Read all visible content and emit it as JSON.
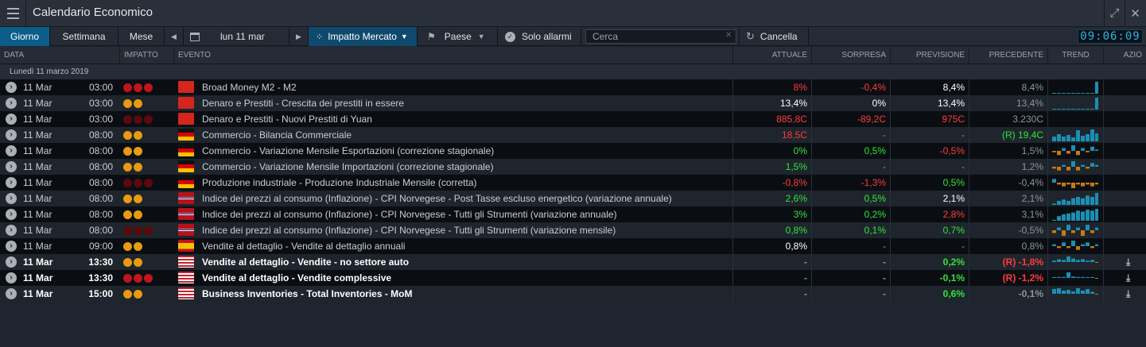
{
  "window": {
    "title": "Calendario Economico",
    "menu_icon": "hamburger-icon",
    "expand_icon": "expand-icon",
    "close_icon": "close-icon"
  },
  "toolbar": {
    "tabs": [
      "Giorno",
      "Settimana",
      "Mese"
    ],
    "date": "lun 11 mar",
    "impact_filter": "Impatto Mercato",
    "country_filter": "Paese",
    "alarms_only": "Solo allarmi",
    "search_placeholder": "Cerca",
    "clear": "Cancella",
    "clock": "09:06:09"
  },
  "columns": [
    "DATA",
    "IMPATTO",
    "EVENTO",
    "ATTUALE",
    "SORPRESA",
    "PREVISIONE",
    "PRECEDENTE",
    "TREND",
    "AZIO"
  ],
  "group_label": "Lunedì 11 marzo 2019",
  "colors": {
    "positive": "#33e33a",
    "negative": "#ff3b3b",
    "trend_up": "#1b8fb3",
    "trend_down": "#c47a15",
    "accent": "#0b5e8a"
  },
  "rows": [
    {
      "date": "11 Mar",
      "time": "03:00",
      "impact": [
        "red",
        "red",
        "red"
      ],
      "flag": "CN",
      "event": "Broad Money M2 - M2",
      "actual": "8%",
      "actual_color": "red",
      "surprise": "-0,4%",
      "surprise_color": "red",
      "forecast": "8,4%",
      "forecast_color": "white",
      "previous": "8,4%",
      "previous_color": "grey",
      "trend": [
        0,
        0,
        0,
        0,
        0,
        0,
        0,
        0,
        0,
        1
      ],
      "bold": false,
      "download": false
    },
    {
      "date": "11 Mar",
      "time": "03:00",
      "impact": [
        "orange",
        "orange"
      ],
      "flag": "CN",
      "event": "Denaro e Prestiti - Crescita dei prestiti in essere",
      "actual": "13,4%",
      "actual_color": "white",
      "surprise": "0%",
      "surprise_color": "white",
      "forecast": "13,4%",
      "forecast_color": "white",
      "previous": "13,4%",
      "previous_color": "grey",
      "trend": [
        0,
        0,
        0,
        0,
        0,
        0,
        0,
        0,
        0,
        1
      ],
      "bold": false,
      "download": false
    },
    {
      "date": "11 Mar",
      "time": "03:00",
      "impact": [
        "darkred",
        "darkred",
        "darkred"
      ],
      "flag": "CN",
      "event": "Denaro e Prestiti - Nuovi Prestiti di Yuan",
      "actual": "885,8C",
      "actual_color": "red",
      "surprise": "-89,2C",
      "surprise_color": "red",
      "forecast": "975C",
      "forecast_color": "red",
      "previous": "3.230C",
      "previous_color": "grey",
      "trend": [],
      "bold": false,
      "download": false
    },
    {
      "date": "11 Mar",
      "time": "08:00",
      "impact": [
        "orange",
        "orange"
      ],
      "flag": "DE",
      "event": "Commercio - Bilancia Commerciale",
      "actual": "18,5C",
      "actual_color": "red",
      "surprise": "-",
      "surprise_color": "grey",
      "forecast": "-",
      "forecast_color": "grey",
      "previous": "(R) 19,4C",
      "previous_color": "green",
      "trend": [
        6,
        9,
        6,
        8,
        5,
        14,
        7,
        9,
        15,
        10
      ],
      "bold": false,
      "download": false
    },
    {
      "date": "11 Mar",
      "time": "08:00",
      "impact": [
        "orange",
        "orange"
      ],
      "flag": "DE",
      "event": "Commercio - Variazione Mensile Esportazioni (correzione stagionale)",
      "actual": "0%",
      "actual_color": "green",
      "surprise": "0,5%",
      "surprise_color": "green",
      "forecast": "-0,5%",
      "forecast_color": "red",
      "previous": "1,5%",
      "previous_color": "grey",
      "trend": [
        -1,
        -3,
        2,
        -2,
        4,
        -3,
        2,
        -1,
        3,
        1
      ],
      "bold": false,
      "download": false
    },
    {
      "date": "11 Mar",
      "time": "08:00",
      "impact": [
        "orange",
        "orange"
      ],
      "flag": "DE",
      "event": "Commercio - Variazione Mensile Importazioni (correzione stagionale)",
      "actual": "1,5%",
      "actual_color": "green",
      "surprise": "-",
      "surprise_color": "grey",
      "forecast": "-",
      "forecast_color": "grey",
      "previous": "1,2%",
      "previous_color": "grey",
      "trend": [
        -1,
        -2,
        1,
        -2,
        3,
        -2,
        1,
        -1,
        2,
        1
      ],
      "bold": false,
      "download": false
    },
    {
      "date": "11 Mar",
      "time": "08:00",
      "impact": [
        "darkred",
        "darkred",
        "darkred"
      ],
      "flag": "DE",
      "event": "Produzione industriale - Produzione Industriale Mensile (corretta)",
      "actual": "-0,8%",
      "actual_color": "red",
      "surprise": "-1,3%",
      "surprise_color": "red",
      "forecast": "0,5%",
      "forecast_color": "green",
      "previous": "-0,4%",
      "previous_color": "grey",
      "trend": [
        2,
        -1,
        -2,
        -1,
        -3,
        -1,
        -2,
        -1,
        -2,
        -1
      ],
      "bold": false,
      "download": false
    },
    {
      "date": "11 Mar",
      "time": "08:00",
      "impact": [
        "orange",
        "orange"
      ],
      "flag": "NO",
      "event": "Indice dei prezzi al consumo (Inflazione) - CPI Norvegese - Post Tasse escluso energetico (variazione annuale)",
      "actual": "2,6%",
      "actual_color": "green",
      "surprise": "0,5%",
      "surprise_color": "green",
      "forecast": "2,1%",
      "forecast_color": "white",
      "previous": "2,1%",
      "previous_color": "grey",
      "trend": [
        1,
        3,
        4,
        3,
        5,
        6,
        5,
        7,
        6,
        9
      ],
      "bold": false,
      "download": false
    },
    {
      "date": "11 Mar",
      "time": "08:00",
      "impact": [
        "orange",
        "orange"
      ],
      "flag": "NO",
      "event": "Indice dei prezzi al consumo (Inflazione) - CPI Norvegese - Tutti gli Strumenti (variazione annuale)",
      "actual": "3%",
      "actual_color": "green",
      "surprise": "0,2%",
      "surprise_color": "green",
      "forecast": "2,8%",
      "forecast_color": "red",
      "previous": "3,1%",
      "previous_color": "grey",
      "trend": [
        1,
        5,
        7,
        8,
        9,
        11,
        10,
        12,
        11,
        13
      ],
      "bold": false,
      "download": false
    },
    {
      "date": "11 Mar",
      "time": "08:00",
      "impact": [
        "darkred",
        "darkred",
        "darkred"
      ],
      "flag": "NO",
      "event": "Indice dei prezzi al consumo (Inflazione) - CPI Norvegese - Tutti gli Strumenti (variazione mensile)",
      "actual": "0,8%",
      "actual_color": "green",
      "surprise": "0,1%",
      "surprise_color": "green",
      "forecast": "0,7%",
      "forecast_color": "green",
      "previous": "-0,5%",
      "previous_color": "grey",
      "trend": [
        -1,
        1,
        -2,
        2,
        -1,
        1,
        -2,
        2,
        -1,
        1
      ],
      "bold": false,
      "download": false
    },
    {
      "date": "11 Mar",
      "time": "09:00",
      "impact": [
        "orange",
        "orange"
      ],
      "flag": "ES",
      "event": "Vendite al dettaglio - Vendite al dettaglio annuali",
      "actual": "0,8%",
      "actual_color": "white",
      "surprise": "-",
      "surprise_color": "grey",
      "forecast": "-",
      "forecast_color": "grey",
      "previous": "0,8%",
      "previous_color": "grey",
      "trend": [
        1,
        -1,
        2,
        -1,
        3,
        -2,
        1,
        2,
        -1,
        1
      ],
      "bold": false,
      "download": false
    },
    {
      "date": "11 Mar",
      "time": "13:30",
      "impact": [
        "orange",
        "orange"
      ],
      "flag": "US",
      "event": "Vendite al dettaglio - Vendite - no settore auto",
      "actual": "-",
      "actual_color": "grey",
      "surprise": "-",
      "surprise_color": "grey",
      "forecast": "0,2%",
      "forecast_color": "green",
      "previous": "(R) -1,8%",
      "previous_color": "red",
      "trend": [
        2,
        4,
        3,
        8,
        5,
        3,
        4,
        2,
        3,
        -1
      ],
      "bold": true,
      "download": true
    },
    {
      "date": "11 Mar",
      "time": "13:30",
      "impact": [
        "red",
        "red",
        "red"
      ],
      "flag": "US",
      "event": "Vendite al dettaglio - Vendite complessive",
      "actual": "-",
      "actual_color": "grey",
      "surprise": "-",
      "surprise_color": "grey",
      "forecast": "-0,1%",
      "forecast_color": "green",
      "previous": "(R) -1,2%",
      "previous_color": "red",
      "trend": [
        1,
        2,
        2,
        12,
        3,
        2,
        2,
        1,
        2,
        -1
      ],
      "bold": true,
      "download": true
    },
    {
      "date": "11 Mar",
      "time": "15:00",
      "impact": [
        "orange",
        "orange"
      ],
      "flag": "US",
      "event": "Business Inventories - Total Inventories - MoM",
      "actual": "-",
      "actual_color": "grey",
      "surprise": "-",
      "surprise_color": "grey",
      "forecast": "0,6%",
      "forecast_color": "green",
      "previous": "-0,1%",
      "previous_color": "grey",
      "trend": [
        12,
        14,
        8,
        10,
        6,
        14,
        8,
        12,
        5,
        -1
      ],
      "bold": true,
      "download": true
    }
  ]
}
